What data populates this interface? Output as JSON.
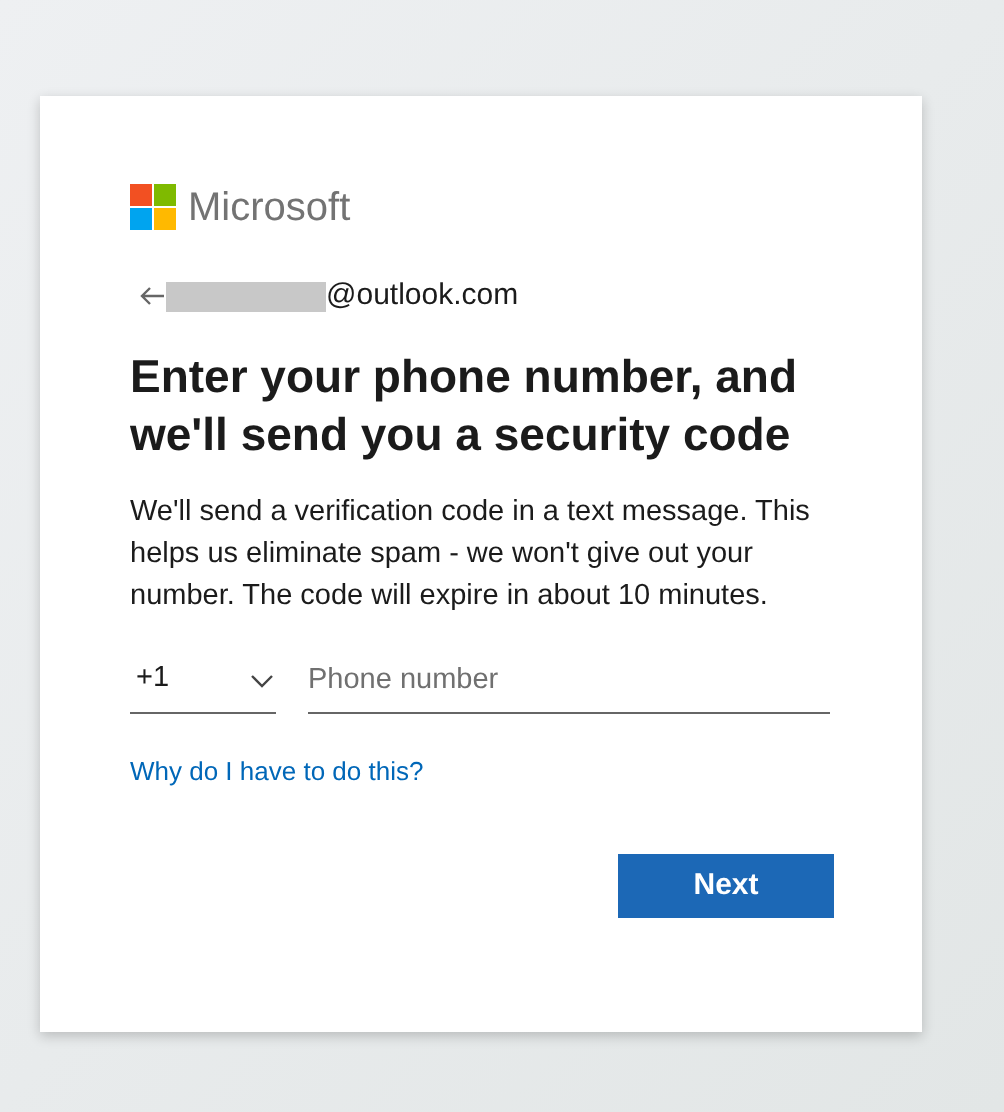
{
  "brand": {
    "name": "Microsoft"
  },
  "account": {
    "email": "@outlook.com",
    "redacted": true
  },
  "title": "Enter your phone number, and we'll send you a security code",
  "description": "We'll send a verification code in a text message. This helps us eliminate spam - we won't give out your number. The code will expire in about 10 minutes.",
  "country_code": {
    "value": "+1"
  },
  "phone": {
    "placeholder": "Phone number"
  },
  "help_link": "Why do I have to do this?",
  "buttons": [
    {
      "label": "Next",
      "kind": "primary"
    }
  ]
}
